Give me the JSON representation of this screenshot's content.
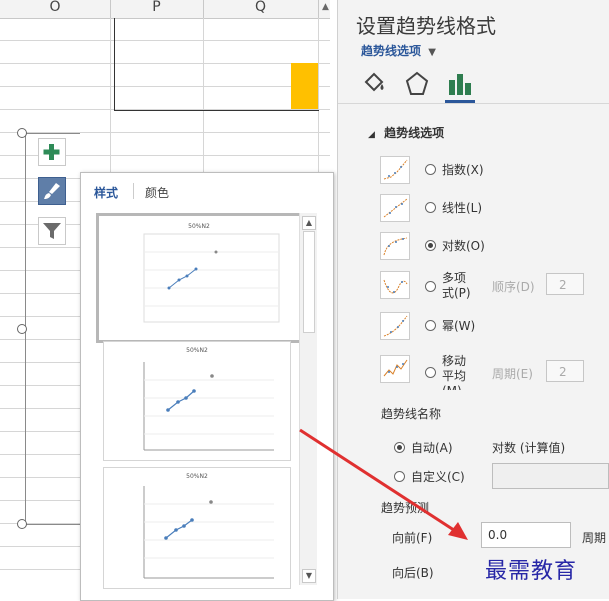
{
  "columns": [
    "O",
    "P",
    "Q"
  ],
  "panel": {
    "title": "设置趋势线格式",
    "subtitle": "趋势线选项",
    "section": "趋势线选项",
    "options": [
      {
        "label": "指数(X)",
        "selected": false
      },
      {
        "label": "线性(L)",
        "selected": false
      },
      {
        "label": "对数(O)",
        "selected": true
      },
      {
        "label": "多项式(P)",
        "selected": false,
        "extra_label": "顺序(D)",
        "extra_value": "2"
      },
      {
        "label": "幂(W)",
        "selected": false
      },
      {
        "label": "移动平均(M)",
        "selected": false,
        "extra_label": "周期(E)",
        "extra_value": "2"
      }
    ],
    "trend_name_heading": "趋势线名称",
    "name_auto": "自动(A)",
    "name_auto_value": "对数 (计算值)",
    "name_custom": "自定义(C)",
    "forecast_heading": "趋势预测",
    "forward_label": "向前(F)",
    "forward_value": "0.0",
    "period_label": "周期",
    "backward_label": "向后(B)"
  },
  "popup": {
    "tab_style": "样式",
    "tab_color": "颜色",
    "preview_title": "50%N2"
  },
  "watermark": "最需教育",
  "colors": {
    "accent": "#2b579a",
    "highlight": "#ffc000",
    "plus": "#2e8b57",
    "arrow": "#e03030"
  }
}
